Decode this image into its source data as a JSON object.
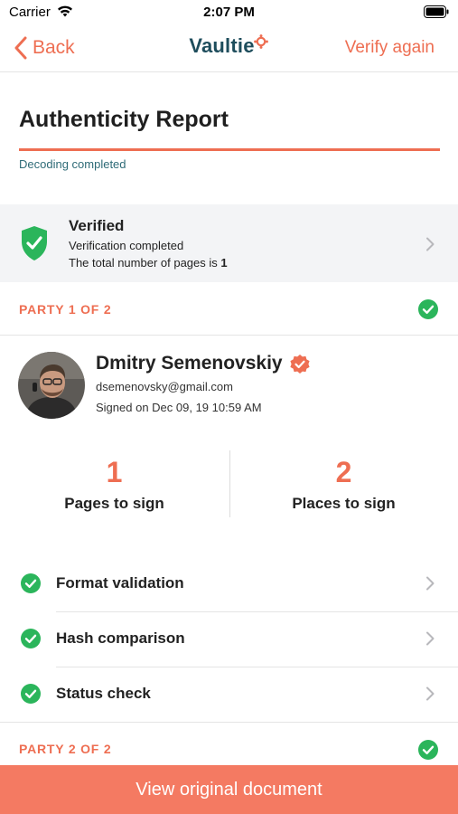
{
  "status_bar": {
    "carrier": "Carrier",
    "time": "2:07 PM"
  },
  "nav": {
    "back_label": "Back",
    "brand_name": "Vaultie",
    "verify_again_label": "Verify again"
  },
  "report": {
    "title": "Authenticity Report",
    "status": "Decoding completed"
  },
  "verification": {
    "title": "Verified",
    "subtitle": "Verification completed",
    "pages_text": "The total number of pages is ",
    "pages_count": "1"
  },
  "parties": [
    {
      "label": "PARTY 1 OF 2"
    },
    {
      "label": "PARTY 2 OF 2"
    }
  ],
  "signer": {
    "name": "Dmitry Semenovskiy",
    "email": "dsemenovsky@gmail.com",
    "signed_on": "Signed on Dec 09, 19 10:59 AM"
  },
  "stats": [
    {
      "value": "1",
      "label": "Pages to sign"
    },
    {
      "value": "2",
      "label": "Places to sign"
    }
  ],
  "checks": [
    {
      "label": "Format validation"
    },
    {
      "label": "Hash comparison"
    },
    {
      "label": "Status check"
    }
  ],
  "footer": {
    "button_label": "View original document"
  },
  "colors": {
    "accent": "#ee6e52",
    "button": "#f47a62",
    "success": "#2bb55b",
    "brand": "#1e4d5c"
  }
}
